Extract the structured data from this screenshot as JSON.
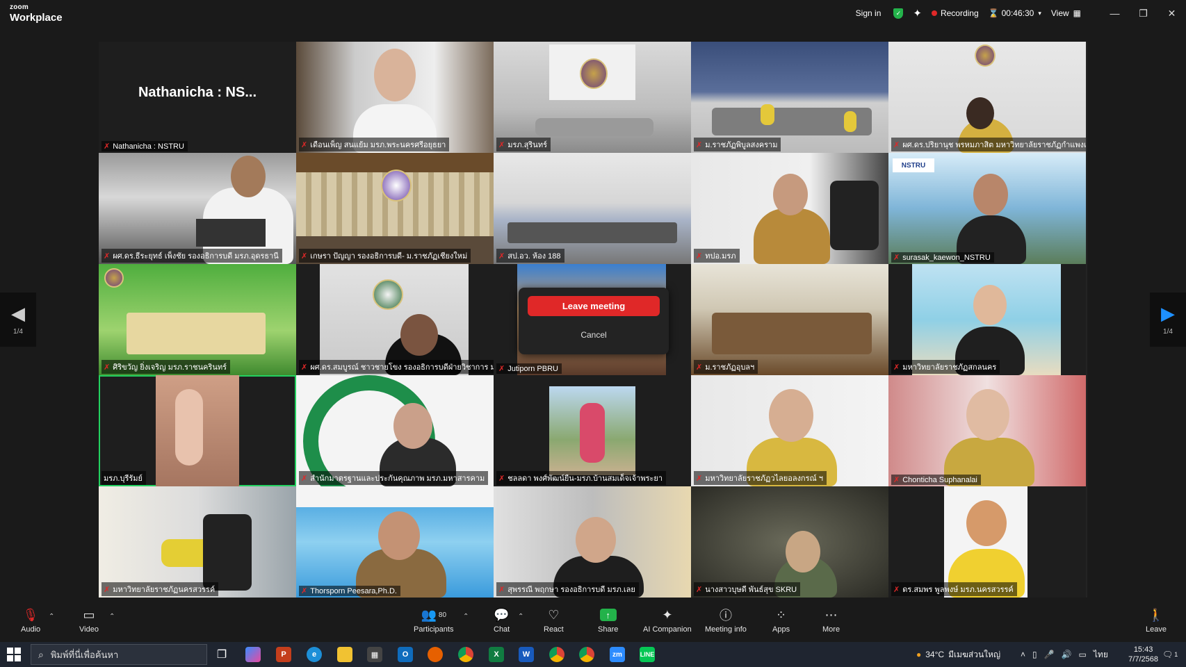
{
  "app": {
    "brand_small": "zoom",
    "brand_large": "Workplace"
  },
  "titlebar": {
    "sign_in": "Sign in",
    "recording": "Recording",
    "timer": "00:46:30",
    "view": "View",
    "icons": [
      "shield-check-icon",
      "sparkle-icon",
      "record-dot-icon",
      "grid-icon",
      "minimize-icon",
      "restore-icon",
      "close-icon"
    ]
  },
  "gallery": {
    "tiles": [
      {
        "name": "Nathanicha : NSTRU",
        "big_name": "Nathanicha : NS...",
        "muted": true,
        "video": false
      },
      {
        "name": "เดือนเพ็ญ สนแย้ม มรภ.พระนครศรีอยุธยา",
        "muted": true
      },
      {
        "name": "มรภ.สุรินทร์",
        "muted": true
      },
      {
        "name": "ม.ราชภัฏพิบูลสงคราม",
        "muted": true
      },
      {
        "name": "ผศ.ดร.ปริยานุช พรหมภาสิต มหาวิทยาลัยราชภัฏกำแพงเพ...",
        "muted": true
      },
      {
        "name": "ผศ.ดร.ธีระยุทธ์ เพ็งชัย รองอธิการบดี มรภ.อุดรธานี",
        "muted": true
      },
      {
        "name": "เกษรา ปัญญา รองอธิการบดี- ม.ราชภัฏเชียงใหม่",
        "muted": true
      },
      {
        "name": "สป.อว. ห้อง 188",
        "muted": true
      },
      {
        "name": "ทปอ.มรภ",
        "muted": true
      },
      {
        "name": "surasak_kaewon_NSTRU",
        "muted": true
      },
      {
        "name": "ศิริขวัญ ยิ่งเจริญ มรภ.ราชนครินทร์",
        "muted": true
      },
      {
        "name": "ผศ.ดร.สมบูรณ์ ชาวชายโขง รองอธิการบดีฝ่ายวิชาการ ม...",
        "muted": true
      },
      {
        "name": "Jutiporn PBRU",
        "muted": true
      },
      {
        "name": "ม.ราชภัฏอุบลฯ",
        "muted": true
      },
      {
        "name": "มหาวิทยาลัยราชภัฏสกลนคร",
        "muted": true
      },
      {
        "name": "มรภ.บุรีรัมย์",
        "muted": false,
        "speaking": true
      },
      {
        "name": "สำนักมาตรฐานและประกันคุณภาพ มรภ.มหาสารคาม",
        "muted": true
      },
      {
        "name": "ชลลดา พงศ์พัฒน์ยืน-มรภ.บ้านสมเด็จเจ้าพระยา",
        "muted": true
      },
      {
        "name": "มหาวิทยาลัยราชภัฏวไลยอลงกรณ์ ฯ",
        "muted": true
      },
      {
        "name": "Chonticha Suphanalai",
        "muted": true
      },
      {
        "name": "มหาวิทยาลัยราชภัฏนครสวรรค์",
        "muted": true
      },
      {
        "name": "Thorsporn Peesara,Ph.D.",
        "muted": true
      },
      {
        "name": "สุพรรณี พฤกษา รองอธิการบดี มรภ.เลย",
        "muted": true
      },
      {
        "name": "นางสาวบุษดี พันธ์สุข SKRU",
        "muted": true
      },
      {
        "name": "ดร.สมพร พูลพงษ์ มรภ.นครสวรรค์",
        "muted": true
      }
    ]
  },
  "popup": {
    "leave_label": "Leave meeting",
    "cancel_label": "Cancel"
  },
  "pager": {
    "left_page": "1/4",
    "right_page": "1/4"
  },
  "toolbar": {
    "audio": "Audio",
    "video": "Video",
    "participants": "Participants",
    "participants_count": "80",
    "chat": "Chat",
    "react": "React",
    "share": "Share",
    "ai": "AI Companion",
    "meeting_info": "Meeting info",
    "apps": "Apps",
    "more": "More",
    "leave": "Leave"
  },
  "taskbar": {
    "search_placeholder": "พิมพ์ที่นี่เพื่อค้นหา",
    "weather_temp": "34°C",
    "weather_desc": "มีเมฆส่วนใหญ่",
    "lang": "ไทย",
    "time": "15:43",
    "date": "7/7/2568",
    "notif_count": "1"
  }
}
